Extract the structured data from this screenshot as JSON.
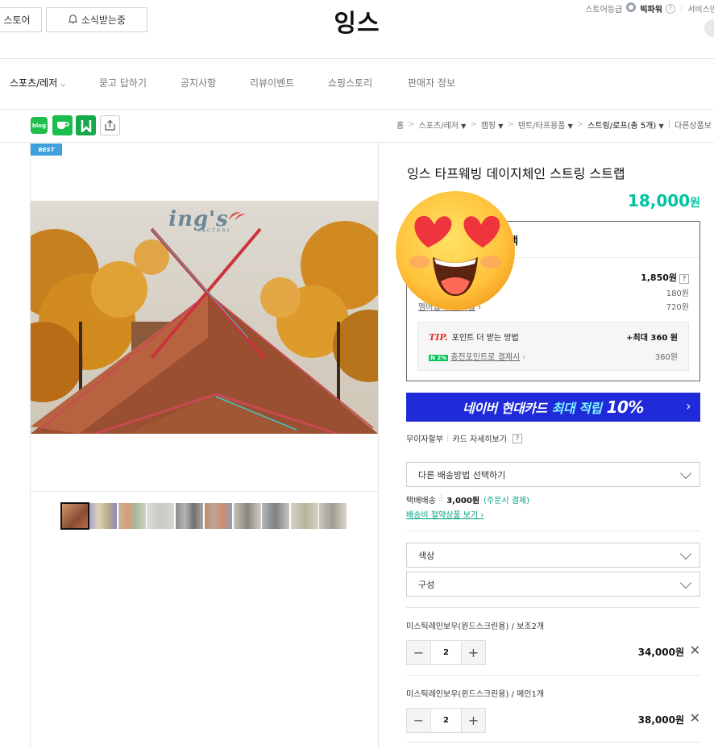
{
  "header": {
    "store_label": "스토어",
    "subscribe_label": "소식받는중",
    "brand_title": "잉스",
    "util_grade": "스토어등급",
    "util_power": "빅파워",
    "util_service": "서비스만"
  },
  "nav": {
    "items": [
      "스포츠/레저",
      "묻고 답하기",
      "공지사항",
      "리뷰이벤트",
      "쇼핑스토리",
      "판매자 정보"
    ]
  },
  "share": {
    "blog": "blog"
  },
  "breadcrumb": [
    "홈",
    "스포츠/레저",
    "캠핑",
    "텐트/타프용품",
    "스트링/로프(총 5개)",
    "다른상품보"
  ],
  "gallery": {
    "badge": "BEST",
    "logo": "ing's",
    "logo_sub": "FACTORY"
  },
  "product": {
    "name": "잉스 타프웨빙 데이지체인 스트링 스트랩",
    "price": "18,000",
    "won": "원"
  },
  "benefits": {
    "head_suffix": "택",
    "total_points": "1,850원",
    "q": "?",
    "row2_value": "180원",
    "row3_label": "멤버십 추가 적립",
    "row3_value": "720원",
    "tip_mark": "TIP.",
    "tip_label": "포인트 더 받는 방법",
    "tip_max": "+최대 360 원",
    "tip_badge": "N 2%",
    "tip_link": "충전포인트로 결제시",
    "tip_value": "360원"
  },
  "card_banner": {
    "text": "네이버 현대카드",
    "highlight": "최대 적립",
    "pct": "10%",
    "arrow": "›"
  },
  "installment": {
    "no_interest": "무이자할부",
    "card_detail": "카드 자세히보기",
    "q": "?"
  },
  "shipping": {
    "method_select": "다른 배송방법 선택하기",
    "type": "택배배송",
    "fee": "3,000원",
    "pay_note": "(주문시 결제)",
    "saving_link": "배송비 절약상품 보기"
  },
  "options": {
    "color_select": "색상",
    "config_select": "구성",
    "items": [
      {
        "name": "미스틱레인보우(윈드스크린용) / 보조2개",
        "qty": "2",
        "price": "34,000원"
      },
      {
        "name": "미스틱레인보우(윈드스크린용) / 메인1개",
        "qty": "2",
        "price": "38,000원"
      }
    ]
  },
  "colors": {
    "price_accent": "#00c4a0",
    "naver_green": "#03c75a",
    "card_blue": "#1f2ad9"
  }
}
